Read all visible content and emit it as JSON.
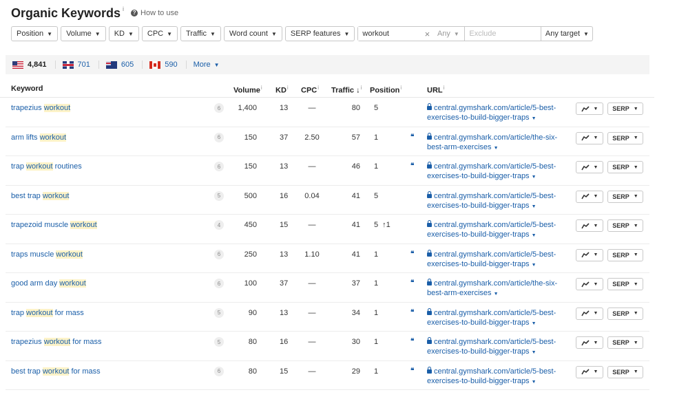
{
  "header": {
    "title": "Organic Keywords",
    "title_info": "i",
    "howto_icon": "?",
    "howto_label": "How to use"
  },
  "filters": {
    "position": "Position",
    "volume": "Volume",
    "kd": "KD",
    "cpc": "CPC",
    "traffic": "Traffic",
    "word_count": "Word count",
    "serp_features": "SERP features",
    "search_value": "workout",
    "any": "Any",
    "exclude_placeholder": "Exclude",
    "target": "Any target"
  },
  "countries": [
    {
      "code": "US",
      "count": "4,841"
    },
    {
      "code": "UK",
      "count": "701"
    },
    {
      "code": "AU",
      "count": "605"
    },
    {
      "code": "CA",
      "count": "590"
    }
  ],
  "more_label": "More",
  "columns": {
    "keyword": "Keyword",
    "volume": "Volume",
    "kd": "KD",
    "cpc": "CPC",
    "traffic": "Traffic",
    "traffic_sort": "↓",
    "position": "Position",
    "url": "URL",
    "info": "i"
  },
  "rows": [
    {
      "kw_pre": "trapezius ",
      "kw_hl": "workout",
      "kw_post": "",
      "serp": "6",
      "volume": "1,400",
      "kd": "13",
      "cpc": "—",
      "traffic": "80",
      "position": "5",
      "change": "",
      "quote": "",
      "url1": "central.gymshark.com/article/5-best-",
      "url2": "exercises-to-build-bigger-traps",
      "url_caret": "▼"
    },
    {
      "kw_pre": "arm lifts ",
      "kw_hl": "workout",
      "kw_post": "",
      "serp": "6",
      "volume": "150",
      "kd": "37",
      "cpc": "2.50",
      "traffic": "57",
      "position": "1",
      "change": "",
      "quote": "❝",
      "url1": "central.gymshark.com/article/the-six-",
      "url2": "best-arm-exercises",
      "url_caret": "▼"
    },
    {
      "kw_pre": "trap ",
      "kw_hl": "workout",
      "kw_post": " routines",
      "serp": "6",
      "volume": "150",
      "kd": "13",
      "cpc": "—",
      "traffic": "46",
      "position": "1",
      "change": "",
      "quote": "❝",
      "url1": "central.gymshark.com/article/5-best-",
      "url2": "exercises-to-build-bigger-traps",
      "url_caret": "▼"
    },
    {
      "kw_pre": "best trap ",
      "kw_hl": "workout",
      "kw_post": "",
      "serp": "5",
      "volume": "500",
      "kd": "16",
      "cpc": "0.04",
      "traffic": "41",
      "position": "5",
      "change": "",
      "quote": "",
      "url1": "central.gymshark.com/article/5-best-",
      "url2": "exercises-to-build-bigger-traps",
      "url_caret": "▼"
    },
    {
      "kw_pre": "trapezoid muscle ",
      "kw_hl": "workout",
      "kw_post": "",
      "serp": "4",
      "volume": "450",
      "kd": "15",
      "cpc": "—",
      "traffic": "41",
      "position": "5",
      "change": "↑1",
      "quote": "",
      "url1": "central.gymshark.com/article/5-best-",
      "url2": "exercises-to-build-bigger-traps",
      "url_caret": "▼"
    },
    {
      "kw_pre": "traps muscle ",
      "kw_hl": "workout",
      "kw_post": "",
      "serp": "6",
      "volume": "250",
      "kd": "13",
      "cpc": "1.10",
      "traffic": "41",
      "position": "1",
      "change": "",
      "quote": "❝",
      "url1": "central.gymshark.com/article/5-best-",
      "url2": "exercises-to-build-bigger-traps",
      "url_caret": "▼"
    },
    {
      "kw_pre": "good arm day ",
      "kw_hl": "workout",
      "kw_post": "",
      "serp": "6",
      "volume": "100",
      "kd": "37",
      "cpc": "—",
      "traffic": "37",
      "position": "1",
      "change": "",
      "quote": "❝",
      "url1": "central.gymshark.com/article/the-six-",
      "url2": "best-arm-exercises",
      "url_caret": "▼"
    },
    {
      "kw_pre": "trap ",
      "kw_hl": "workout",
      "kw_post": " for mass",
      "serp": "5",
      "volume": "90",
      "kd": "13",
      "cpc": "—",
      "traffic": "34",
      "position": "1",
      "change": "",
      "quote": "❝",
      "url1": "central.gymshark.com/article/5-best-",
      "url2": "exercises-to-build-bigger-traps",
      "url_caret": "▼"
    },
    {
      "kw_pre": "trapezius ",
      "kw_hl": "workout",
      "kw_post": " for mass",
      "serp": "5",
      "volume": "80",
      "kd": "16",
      "cpc": "—",
      "traffic": "30",
      "position": "1",
      "change": "",
      "quote": "❝",
      "url1": "central.gymshark.com/article/5-best-",
      "url2": "exercises-to-build-bigger-traps",
      "url_caret": "▼"
    },
    {
      "kw_pre": "best trap ",
      "kw_hl": "workout",
      "kw_post": " for mass",
      "serp": "6",
      "volume": "80",
      "kd": "15",
      "cpc": "—",
      "traffic": "29",
      "position": "1",
      "change": "",
      "quote": "❝",
      "url1": "central.gymshark.com/article/5-best-",
      "url2": "exercises-to-build-bigger-traps",
      "url_caret": "▼"
    }
  ],
  "row_buttons": {
    "chart_icon": "trend-line-icon",
    "serp_label": "SERP",
    "caret": "▼"
  },
  "colors": {
    "link": "#1a5ea8",
    "highlight": "#fdf3c8",
    "country_bar": "#f4f4f4"
  }
}
